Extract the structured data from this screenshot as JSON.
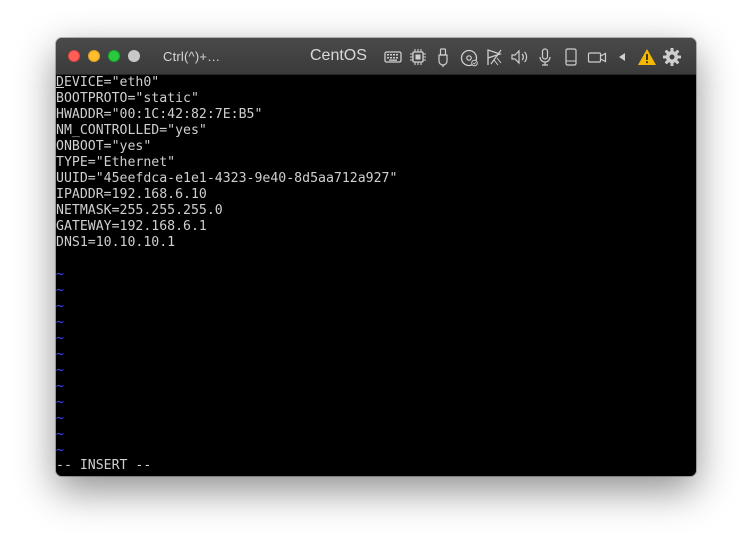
{
  "window": {
    "title": "CentOS",
    "shortcut_label": "Ctrl(^)+…"
  },
  "toolbar_icons": [
    "keyboard-icon",
    "cpu-icon",
    "usb-icon",
    "disc-icon",
    "network-icon",
    "speaker-icon",
    "microphone-icon",
    "device-icon",
    "camera-icon",
    "back-arrow-icon",
    "warning-icon",
    "gear-icon"
  ],
  "colors": {
    "titlebar": "#404040",
    "terminal_bg": "#000000",
    "terminal_fg": "#cfcfcf",
    "tilde": "#3b4fff",
    "warning": "#f5b800"
  },
  "editor": {
    "first_line_first_char": "D",
    "first_line_rest": "EVICE=\"eth0\"",
    "lines": [
      "BOOTPROTO=\"static\"",
      "HWADDR=\"00:1C:42:82:7E:B5\"",
      "NM_CONTROLLED=\"yes\"",
      "ONBOOT=\"yes\"",
      "TYPE=\"Ethernet\"",
      "UUID=\"45eefdca-e1e1-4323-9e40-8d5aa712a927\"",
      "IPADDR=192.168.6.10",
      "NETMASK=255.255.255.0",
      "GATEWAY=192.168.6.1",
      "DNS1=10.10.10.1",
      ""
    ],
    "tildes": [
      "~",
      "~",
      "~",
      "~",
      "~",
      "~",
      "~",
      "~",
      "~",
      "~",
      "~",
      "~"
    ],
    "mode": "-- INSERT --"
  }
}
